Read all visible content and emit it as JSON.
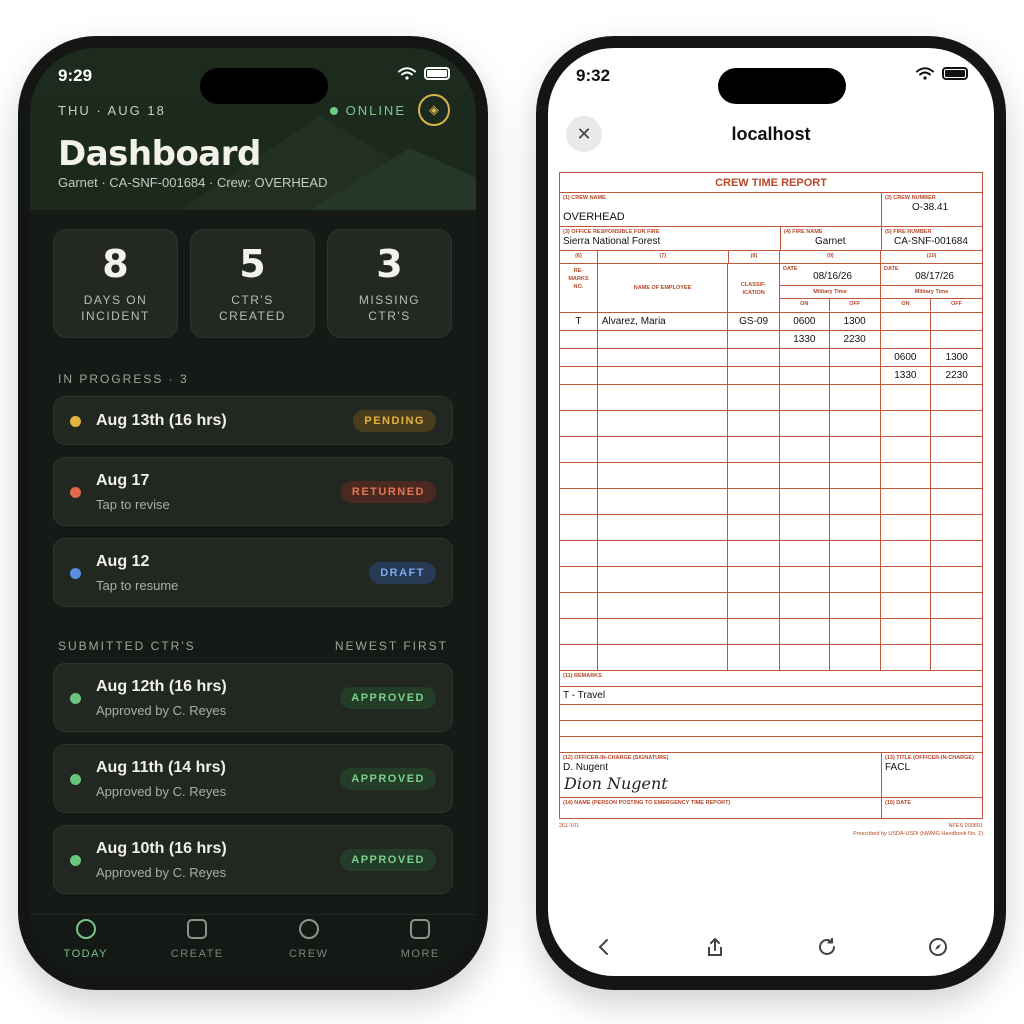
{
  "left": {
    "time": "9:29",
    "date": "THU · AUG 18",
    "online": "ONLINE",
    "title": "Dashboard",
    "subtitle": "Garnet · CA-SNF-001684 · Crew: OVERHEAD",
    "stats": [
      {
        "num": "8",
        "label": "DAYS ON\nINCIDENT"
      },
      {
        "num": "5",
        "label": "CTR'S\nCREATED"
      },
      {
        "num": "3",
        "label": "MISSING\nCTR'S"
      }
    ],
    "in_progress_label": "IN PROGRESS · 3",
    "in_progress": [
      {
        "title": "Aug 13th (16 hrs)",
        "sub": "",
        "status": "PENDING"
      },
      {
        "title": "Aug 17",
        "sub": "Tap to revise",
        "status": "RETURNED"
      },
      {
        "title": "Aug 12",
        "sub": "Tap to resume",
        "status": "DRAFT"
      }
    ],
    "submitted_label": "SUBMITTED CTR'S",
    "sort_label": "NEWEST FIRST",
    "submitted": [
      {
        "title": "Aug 12th (16 hrs)",
        "sub": "Approved by C. Reyes",
        "status": "APPROVED"
      },
      {
        "title": "Aug 11th (14 hrs)",
        "sub": "Approved by C. Reyes",
        "status": "APPROVED"
      },
      {
        "title": "Aug 10th (16 hrs)",
        "sub": "Approved by C. Reyes",
        "status": "APPROVED"
      }
    ],
    "tabs": [
      "TODAY",
      "CREATE",
      "CREW",
      "MORE"
    ]
  },
  "right": {
    "time": "9:32",
    "host": "localhost",
    "form": {
      "title": "CREW TIME REPORT",
      "crew_name_cap": "(1) CREW NAME",
      "crew_name": "OVERHEAD",
      "crew_number_cap": "(2) CREW NUMBER",
      "crew_number": "O-38.41",
      "office_cap": "(3) OFFICE RESPONSIBLE FOR FIRE",
      "office": "Sierra National Forest",
      "fire_name_cap": "(4) FIRE NAME",
      "fire_name": "Garnet",
      "fire_number_cap": "(5) FIRE NUMBER",
      "fire_number": "CA-SNF-001684",
      "col_nums": [
        "(6)",
        "(7)",
        "(8)",
        "(9)",
        "(10)"
      ],
      "remarks_no": "RE-\nMARKS\nNO.",
      "employee_head": "NAME OF EMPLOYEE",
      "class_head": "CLASSIF-\nICATION",
      "date_label": "DATE",
      "date1": "08/16/26",
      "date2": "08/17/26",
      "mil_time": "Military Time",
      "on": "ON",
      "off": "OFF",
      "rows": [
        [
          "T",
          "Alvarez, Maria",
          "GS-09",
          "0600",
          "1300",
          "",
          ""
        ],
        [
          "",
          "",
          "",
          "1330",
          "2230",
          "",
          ""
        ],
        [
          "",
          "",
          "",
          "",
          "",
          "0600",
          "1300"
        ],
        [
          "",
          "",
          "",
          "",
          "",
          "1330",
          "2230"
        ]
      ],
      "remarks_cap": "(11) REMARKS",
      "remarks": "T - Travel",
      "officer_cap": "(12) OFFICER-IN-CHARGE (Signature)",
      "officer": "D. Nugent",
      "signature": "Dion Nugent",
      "title_cap": "(13) TITLE (Officer-in-Charge)",
      "officer_title": "FACL",
      "name_cap": "(14) NAME (Person Posting to Emergency Time Report)",
      "date_cap": "(15) DATE",
      "form_no": "261-101",
      "nfes": "NFES 000891",
      "prescribed": "Prescribed by USDA-USDI (NWMG Handbook No. 2)"
    }
  },
  "colors": {
    "pending": "#e3b340",
    "returned": "#de6a4b",
    "draft": "#5a8ee0",
    "approved": "#69c57d",
    "form_red": "#b5482a"
  }
}
